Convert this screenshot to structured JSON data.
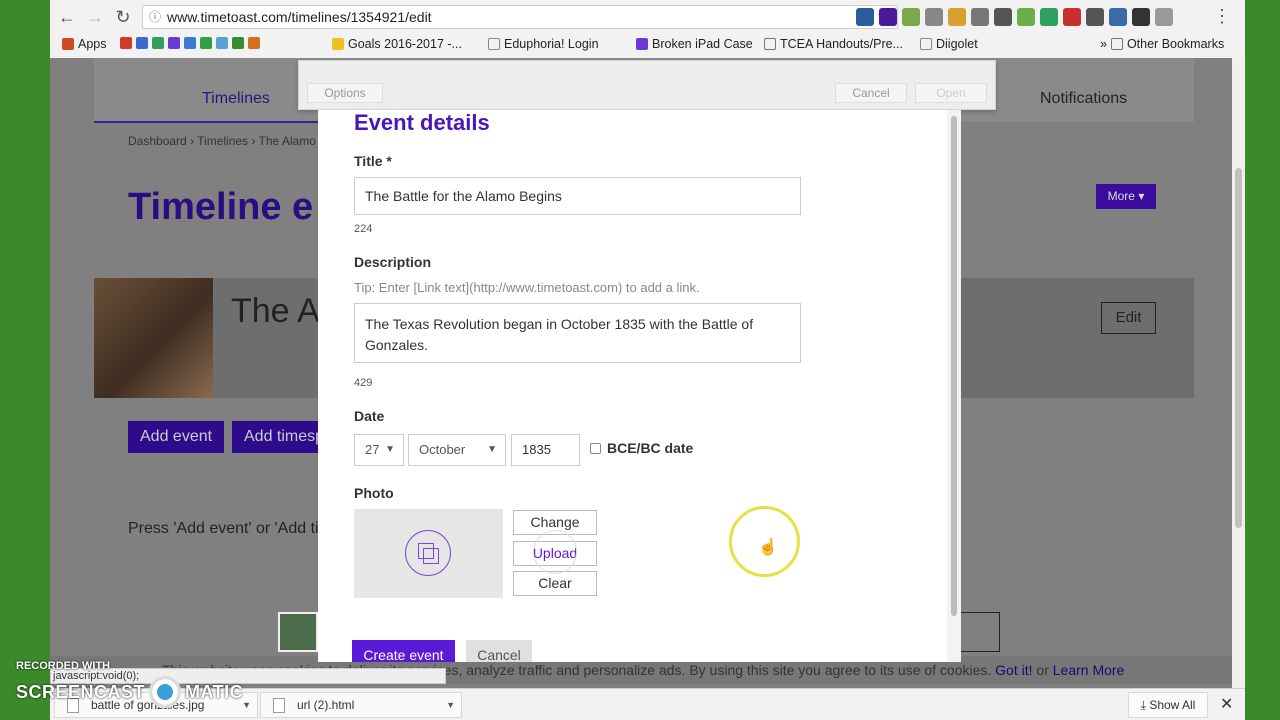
{
  "browser": {
    "url": "www.timetoast.com/timelines/1354921/edit",
    "bookmarks": [
      {
        "label": "Apps"
      },
      {
        "label": "Goals 2016-2017 -..."
      },
      {
        "label": "Eduphoria! Login"
      },
      {
        "label": "Broken iPad Case"
      },
      {
        "label": "TCEA Handouts/Pre..."
      },
      {
        "label": "Diigolet"
      }
    ],
    "other_bookmarks": "Other Bookmarks",
    "status_text": "javascript:void(0);"
  },
  "site": {
    "nav_timelines": "Timelines",
    "nav_notifications": "Notifications",
    "breadcrumb": "Dashboard › Timelines › The Alamo",
    "page_title": "Timeline e",
    "more_label": "More ▾",
    "timeline_name": "The A",
    "edit_label": "Edit",
    "add_event": "Add event",
    "add_timespan": "Add timesp",
    "press_text": "Press 'Add event' or 'Add ti",
    "cookie_text": "This website uses cookies to deliver its services, analyze traffic and personalize ads. By using this site you agree to its use of cookies.",
    "cookie_got_it": "Got it!",
    "cookie_or": "or",
    "cookie_learn_more": "Learn More"
  },
  "file_picker": {
    "options": "Options",
    "cancel": "Cancel",
    "open": "Open"
  },
  "modal": {
    "heading": "Event details",
    "title_label": "Title *",
    "title_value": "The Battle for the Alamo Begins",
    "title_count": "224",
    "description_label": "Description",
    "description_tip": "Tip: Enter [Link text](http://www.timetoast.com) to add a link.",
    "description_value": "The Texas Revolution began in October 1835 with the Battle of Gonzales.",
    "description_count": "429",
    "date_label": "Date",
    "date_day": "27",
    "date_month": "October",
    "date_year": "1835",
    "bce_label": "BCE/BC date",
    "photo_label": "Photo",
    "change": "Change",
    "upload": "Upload",
    "clear": "Clear",
    "create": "Create event",
    "cancel": "Cancel"
  },
  "downloads": {
    "items": [
      {
        "name": "battle of gonzales.jpg"
      },
      {
        "name": "url (2).html"
      }
    ],
    "show_all": "Show All"
  },
  "watermark": {
    "line1": "RECORDED WITH",
    "line2a": "SCREENCAST",
    "line2b": "MATIC"
  }
}
